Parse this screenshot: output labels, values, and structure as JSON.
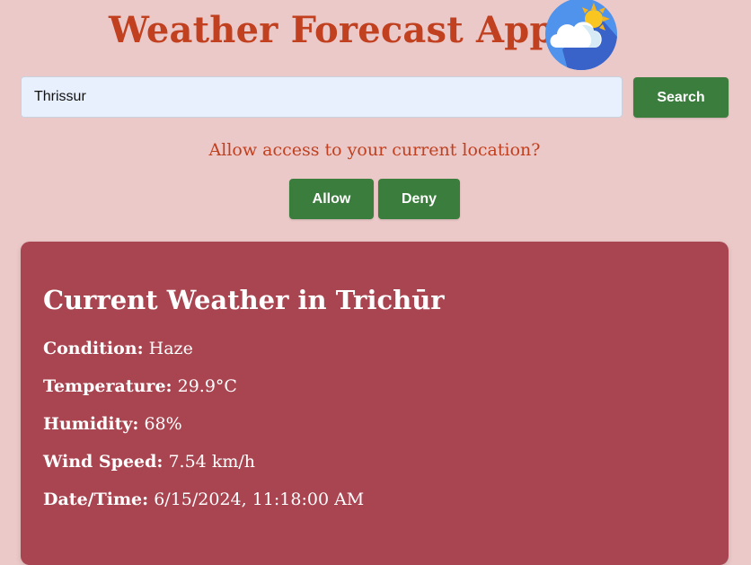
{
  "header": {
    "title": "Weather Forecast App",
    "logo_icon": "cloud-sun-icon"
  },
  "search": {
    "value": "Thrissur",
    "button_label": "Search"
  },
  "location_prompt": {
    "text": "Allow access to your current location?",
    "allow_label": "Allow",
    "deny_label": "Deny"
  },
  "weather": {
    "heading": "Current Weather in Trichūr",
    "condition_label": "Condition:",
    "condition_value": "Haze",
    "temperature_label": "Temperature:",
    "temperature_value": "29.9°C",
    "humidity_label": "Humidity:",
    "humidity_value": "68%",
    "wind_label": "Wind Speed:",
    "wind_value": "7.54 km/h",
    "datetime_label": "Date/Time:",
    "datetime_value": "6/15/2024, 11:18:00 AM"
  },
  "colors": {
    "page_background": "#ecc9c9",
    "title": "#c0401f",
    "button": "#3a7d3c",
    "card": "#a94551",
    "input_background": "#e8f0fe"
  }
}
